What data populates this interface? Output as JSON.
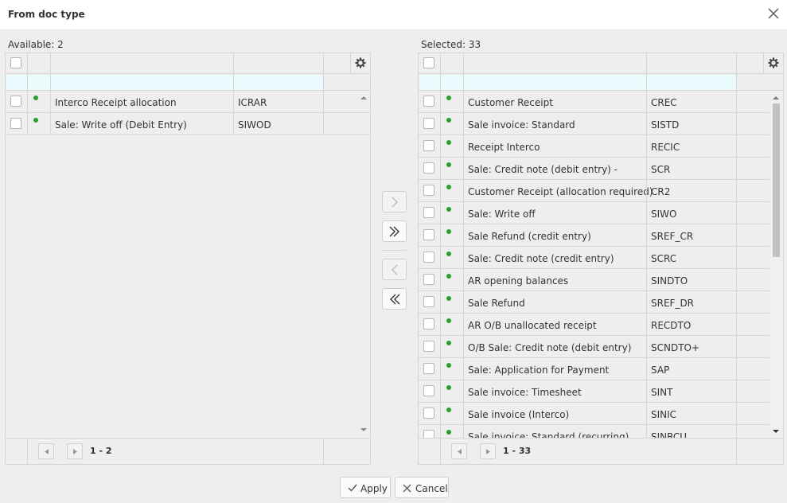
{
  "dialog": {
    "title": "From doc type"
  },
  "available": {
    "label": "Available: 2",
    "pager": "1 - 2",
    "rows": [
      {
        "name": "Interco Receipt allocation",
        "code": "ICRAR"
      },
      {
        "name": "Sale: Write off (Debit Entry)",
        "code": "SIWOD"
      }
    ]
  },
  "selected": {
    "label": "Selected: 33",
    "pager": "1 - 33",
    "rows": [
      {
        "name": "Customer Receipt",
        "code": "CREC"
      },
      {
        "name": "Sale invoice: Standard",
        "code": "SISTD"
      },
      {
        "name": "Receipt Interco",
        "code": "RECIC"
      },
      {
        "name": "Sale: Credit note (debit entry) -",
        "code": "SCR"
      },
      {
        "name": "Customer Receipt (allocation required)",
        "code": "CR2"
      },
      {
        "name": "Sale: Write off",
        "code": "SIWO"
      },
      {
        "name": "Sale Refund (credit entry)",
        "code": "SREF_CR"
      },
      {
        "name": "Sale: Credit note (credit entry)",
        "code": "SCRC"
      },
      {
        "name": "AR opening balances",
        "code": "SINDTO"
      },
      {
        "name": "Sale Refund",
        "code": "SREF_DR"
      },
      {
        "name": "AR O/B unallocated receipt",
        "code": "RECDTO"
      },
      {
        "name": "O/B Sale: Credit note (debit entry)",
        "code": "SCNDTO+"
      },
      {
        "name": "Sale: Application for Payment",
        "code": "SAP"
      },
      {
        "name": "Sale invoice: Timesheet",
        "code": "SINT"
      },
      {
        "name": "Sale invoice (Interco)",
        "code": "SINIC"
      },
      {
        "name": "Sale invoice: Standard (recurring)",
        "code": "SINRCU"
      }
    ]
  },
  "footer": {
    "apply_label": "Apply",
    "cancel_label": "Cancel"
  },
  "colors": {
    "status_dot": "#28a02d",
    "filter_row": "#eafbfe"
  }
}
